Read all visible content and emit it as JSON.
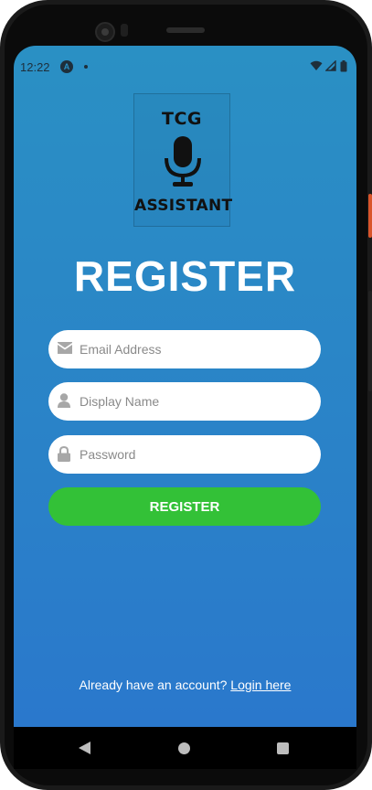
{
  "status_bar": {
    "time": "12:22",
    "app_icon_letter": "A",
    "icons": [
      "wifi-icon",
      "signal-icon",
      "battery-icon"
    ]
  },
  "logo": {
    "top_text": "TCG",
    "bottom_text": "ASSISTANT",
    "icon": "microphone-icon"
  },
  "page": {
    "title": "REGISTER"
  },
  "form": {
    "email": {
      "placeholder": "Email Address",
      "value": "",
      "icon": "envelope-icon"
    },
    "display_name": {
      "placeholder": "Display Name",
      "value": "",
      "icon": "user-icon"
    },
    "password": {
      "placeholder": "Password",
      "value": "",
      "icon": "lock-icon"
    },
    "submit_label": "REGISTER"
  },
  "footer": {
    "prompt": "Already have an account?",
    "link_label": "Login here"
  },
  "navigation_bar": {
    "buttons": [
      "back-icon",
      "home-icon",
      "recents-icon"
    ]
  },
  "colors": {
    "background_top": "#2a90c4",
    "background_bottom": "#2a78cc",
    "accent_green": "#33c137",
    "text_light": "#ffffff"
  }
}
